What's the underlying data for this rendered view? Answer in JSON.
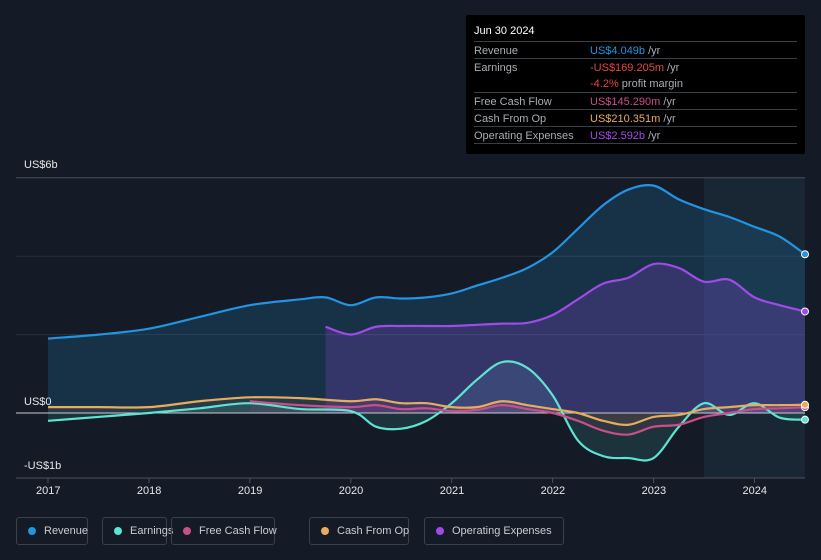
{
  "tooltip": {
    "date": "Jun 30 2024",
    "rows": [
      {
        "label": "Revenue",
        "value": "US$4.049b",
        "unit": " /yr",
        "color": "#2394df"
      },
      {
        "label": "Earnings",
        "value": "-US$169.205m",
        "unit": " /yr",
        "color": "#e64545"
      },
      {
        "label": "",
        "value": "-4.2%",
        "unit": " profit margin",
        "color": "#e64545"
      },
      {
        "label": "Free Cash Flow",
        "value": "US$145.290m",
        "unit": " /yr",
        "color": "#c94f8a"
      },
      {
        "label": "Cash From Op",
        "value": "US$210.351m",
        "unit": " /yr",
        "color": "#e8ac5d"
      },
      {
        "label": "Operating Expenses",
        "value": "US$2.592b",
        "unit": " /yr",
        "color": "#a04ae8"
      }
    ]
  },
  "legend": [
    {
      "label": "Revenue",
      "color": "#2394df"
    },
    {
      "label": "Earnings",
      "color": "#5ee3d2"
    },
    {
      "label": "Free Cash Flow",
      "color": "#c94f8a"
    },
    {
      "label": "Cash From Op",
      "color": "#e8ac5d"
    },
    {
      "label": "Operating Expenses",
      "color": "#a04ae8"
    }
  ],
  "chart_data": {
    "type": "line",
    "title": "",
    "xlabel": "",
    "ylabel": "",
    "ylim": [
      -1,
      6
    ],
    "y_ticks": [
      {
        "value": 6,
        "label": "US$6b"
      },
      {
        "value": 0,
        "label": "US$0"
      },
      {
        "value": -1,
        "label": "-US$1b"
      }
    ],
    "x_ticks": [
      "2017",
      "2018",
      "2019",
      "2020",
      "2021",
      "2022",
      "2023",
      "2024"
    ],
    "xlim": [
      2017.0,
      2024.5
    ],
    "forecast_shaded_from": 2023.5,
    "grid": true,
    "legend_position": "bottom-left",
    "series": [
      {
        "name": "Revenue",
        "color": "#2394df",
        "x": [
          2017.0,
          2017.5,
          2018.0,
          2018.5,
          2019.0,
          2019.5,
          2019.75,
          2020.0,
          2020.25,
          2020.5,
          2020.75,
          2021.0,
          2021.25,
          2021.5,
          2021.75,
          2022.0,
          2022.25,
          2022.5,
          2022.75,
          2023.0,
          2023.25,
          2023.5,
          2023.75,
          2024.0,
          2024.25,
          2024.5
        ],
        "values": [
          1.9,
          2.0,
          2.15,
          2.45,
          2.75,
          2.9,
          2.95,
          2.75,
          2.95,
          2.92,
          2.95,
          3.05,
          3.25,
          3.45,
          3.7,
          4.1,
          4.7,
          5.3,
          5.7,
          5.8,
          5.45,
          5.2,
          5.0,
          4.75,
          4.5,
          4.05
        ]
      },
      {
        "name": "Earnings",
        "color": "#5ee3d2",
        "x": [
          2017.0,
          2017.5,
          2018.0,
          2018.5,
          2019.0,
          2019.5,
          2020.0,
          2020.25,
          2020.5,
          2020.75,
          2021.0,
          2021.25,
          2021.5,
          2021.75,
          2022.0,
          2022.25,
          2022.5,
          2022.75,
          2023.0,
          2023.25,
          2023.5,
          2023.75,
          2024.0,
          2024.25,
          2024.5
        ],
        "values": [
          -0.2,
          -0.1,
          0.0,
          0.12,
          0.25,
          0.1,
          0.05,
          -0.35,
          -0.4,
          -0.2,
          0.25,
          0.85,
          1.3,
          1.15,
          0.45,
          -0.7,
          -1.1,
          -1.15,
          -1.15,
          -0.35,
          0.25,
          -0.05,
          0.25,
          -0.12,
          -0.17
        ]
      },
      {
        "name": "Free Cash Flow",
        "color": "#c94f8a",
        "x": [
          2019.0,
          2019.5,
          2020.0,
          2020.25,
          2020.5,
          2020.75,
          2021.0,
          2021.25,
          2021.5,
          2021.75,
          2022.0,
          2022.25,
          2022.5,
          2022.75,
          2023.0,
          2023.25,
          2023.5,
          2023.75,
          2024.0,
          2024.25,
          2024.5
        ],
        "values": [
          0.3,
          0.2,
          0.15,
          0.2,
          0.1,
          0.12,
          0.05,
          0.08,
          0.2,
          0.1,
          0.0,
          -0.2,
          -0.45,
          -0.55,
          -0.35,
          -0.3,
          -0.1,
          0.0,
          0.1,
          0.12,
          0.15
        ]
      },
      {
        "name": "Cash From Op",
        "color": "#e8ac5d",
        "x": [
          2017.0,
          2017.5,
          2018.0,
          2018.5,
          2019.0,
          2019.5,
          2020.0,
          2020.25,
          2020.5,
          2020.75,
          2021.0,
          2021.25,
          2021.5,
          2021.75,
          2022.0,
          2022.25,
          2022.5,
          2022.75,
          2023.0,
          2023.25,
          2023.5,
          2023.75,
          2024.0,
          2024.25,
          2024.5
        ],
        "values": [
          0.15,
          0.15,
          0.15,
          0.3,
          0.4,
          0.38,
          0.3,
          0.35,
          0.25,
          0.25,
          0.15,
          0.15,
          0.3,
          0.2,
          0.1,
          0.0,
          -0.2,
          -0.3,
          -0.1,
          -0.05,
          0.1,
          0.15,
          0.2,
          0.2,
          0.21
        ]
      },
      {
        "name": "Operating Expenses",
        "color": "#a04ae8",
        "x": [
          2019.75,
          2020.0,
          2020.25,
          2020.5,
          2020.75,
          2021.0,
          2021.25,
          2021.5,
          2021.75,
          2022.0,
          2022.25,
          2022.5,
          2022.75,
          2023.0,
          2023.25,
          2023.5,
          2023.75,
          2024.0,
          2024.25,
          2024.5
        ],
        "values": [
          2.2,
          2.0,
          2.2,
          2.22,
          2.22,
          2.22,
          2.25,
          2.28,
          2.3,
          2.5,
          2.9,
          3.3,
          3.45,
          3.8,
          3.7,
          3.35,
          3.4,
          2.95,
          2.75,
          2.59
        ]
      }
    ]
  }
}
